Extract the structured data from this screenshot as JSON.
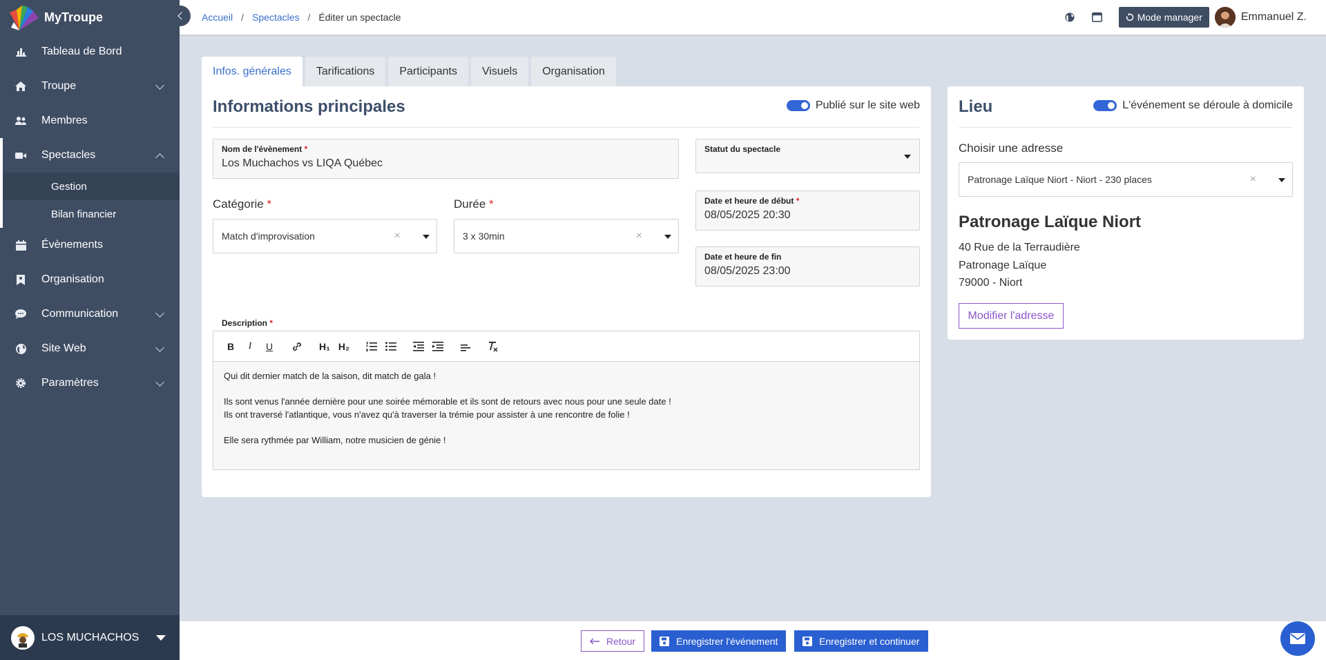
{
  "brand": {
    "name": "MyTroupe"
  },
  "sidebar": {
    "items": [
      {
        "label": "Tableau de Bord",
        "icon": "chart-bar-icon"
      },
      {
        "label": "Troupe",
        "icon": "home-icon"
      },
      {
        "label": "Membres",
        "icon": "users-icon"
      },
      {
        "label": "Spectacles",
        "icon": "video-camera-icon"
      },
      {
        "label": "Évènements",
        "icon": "calendar-icon"
      },
      {
        "label": "Organisation",
        "icon": "bookmark-icon"
      },
      {
        "label": "Communication",
        "icon": "chat-icon"
      },
      {
        "label": "Site Web",
        "icon": "globe-icon"
      },
      {
        "label": "Paramètres",
        "icon": "gear-icon"
      }
    ],
    "sub_items": [
      "Gestion",
      "Bilan financier"
    ],
    "troupe_name": "LOS MUCHACHOS"
  },
  "breadcrumb": {
    "home": "Accueil",
    "section": "Spectacles",
    "current": "Éditer un spectacle",
    "separator": "/"
  },
  "topbar": {
    "manager_label": "Mode manager",
    "user_name": "Emmanuel Z."
  },
  "tabs": [
    "Infos. générales",
    "Tarifications",
    "Participants",
    "Visuels",
    "Organisation"
  ],
  "main": {
    "title": "Informations principales",
    "published_label": "Publié sur le site web",
    "event_name_label": "Nom de l'évènement",
    "event_name_value": "Los Muchachos vs LIQA Québec",
    "status_label": "Statut du spectacle",
    "category_label": "Catégorie",
    "category_value": "Match d'improvisation",
    "duration_label": "Durée",
    "duration_value": "3 x 30min",
    "start_label": "Date et heure de début",
    "start_value": "08/05/2025 20:30",
    "end_label": "Date et heure de fin",
    "end_value": "08/05/2025 23:00",
    "description_label": "Description",
    "required_mark": "*",
    "clear_mark": "×",
    "toolbar_labels": {
      "h1": "H₁",
      "h2": "H₂"
    },
    "description_lines": [
      "Qui dit dernier match de la saison, dit match de gala !",
      "",
      "Ils sont venus l'année dernière pour une soirée mémorable et ils sont de retours avec nous pour une seule date !",
      "Ils ont traversé l'atlantique, vous n'avez qu'à traverser la trémie pour assister à une rencontre de folie !",
      "",
      "Elle sera rythmée par William, notre musicien de génie !"
    ]
  },
  "lieu": {
    "title": "Lieu",
    "home_toggle_label": "L'événement se déroule à domicile",
    "choose_label": "Choisir une adresse",
    "address_select_value": "Patronage Laïque Niort - Niort - 230 places",
    "venue_name": "Patronage Laïque Niort",
    "address_lines": [
      "40 Rue de la Terraudière",
      "Patronage Laïque",
      "79000 - Niort"
    ],
    "edit_button": "Modifier l'adresse"
  },
  "footer": {
    "back_label": "Retour",
    "save_label": "Enregistrer l'événement",
    "save_continue_label": "Enregistrer et continuer"
  },
  "colors": {
    "sidebar": "#3f4d63",
    "accent_blue": "#2a5fd1",
    "link_blue": "#3a6fcb",
    "outline_purple": "#8a55c9",
    "required_red": "#e0262a"
  }
}
